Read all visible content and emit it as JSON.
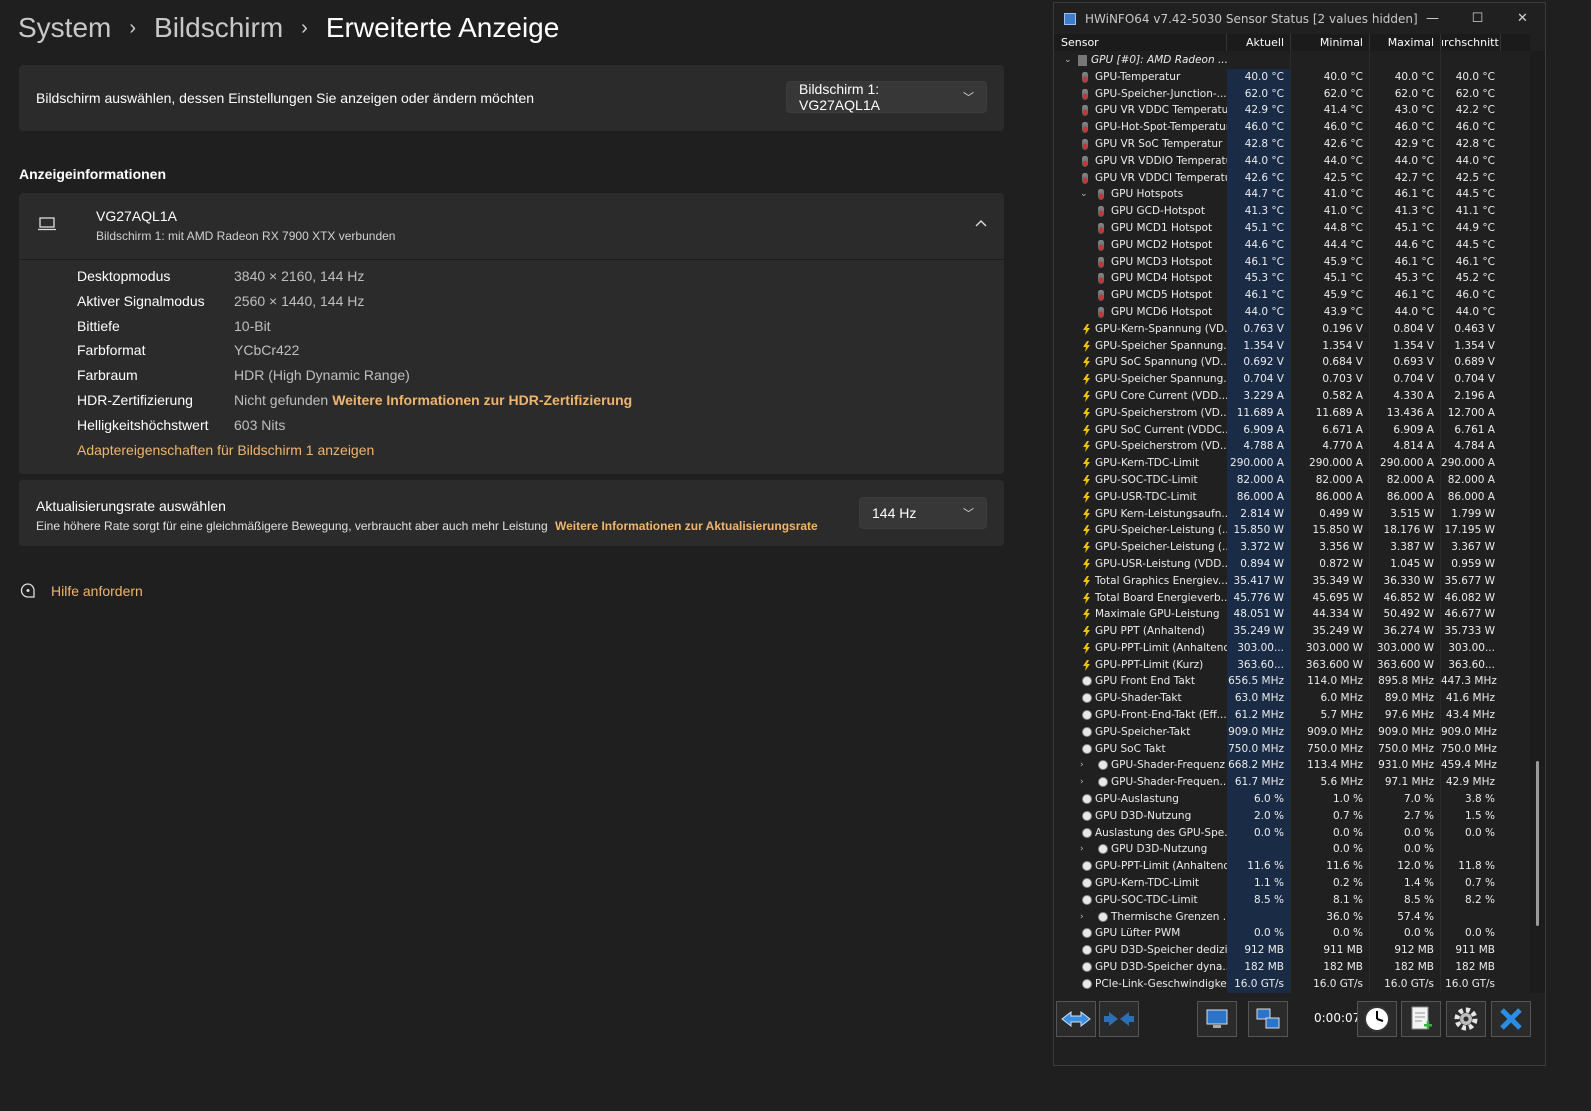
{
  "breadcrumb": {
    "system": "System",
    "bildschirm": "Bildschirm",
    "current": "Erweiterte Anzeige"
  },
  "monitor_select": {
    "label": "Bildschirm auswählen, dessen Einstellungen Sie anzeigen oder ändern möchten",
    "value": "Bildschirm 1: VG27AQL1A"
  },
  "section_title": "Anzeigeinformationen",
  "display": {
    "name": "VG27AQL1A",
    "subtitle": "Bildschirm 1: mit AMD Radeon RX 7900 XTX verbunden",
    "rows": [
      {
        "k": "Desktopmodus",
        "v": "3840 × 2160, 144 Hz"
      },
      {
        "k": "Aktiver Signalmodus",
        "v": "2560 × 1440, 144 Hz"
      },
      {
        "k": "Bittiefe",
        "v": "10-Bit"
      },
      {
        "k": "Farbformat",
        "v": "YCbCr422"
      },
      {
        "k": "Farbraum",
        "v": "HDR (High Dynamic Range)"
      },
      {
        "k": "HDR-Zertifizierung",
        "v": "Nicht gefunden",
        "link": "Weitere Informationen zur HDR-Zertifizierung"
      },
      {
        "k": "Helligkeitshöchstwert",
        "v": "603 Nits"
      }
    ],
    "adapter_link": "Adaptereigenschaften für Bildschirm 1 anzeigen"
  },
  "refresh": {
    "title": "Aktualisierungsrate auswählen",
    "subtitle": "Eine höhere Rate sorgt für eine gleichmäßigere Bewegung, verbraucht aber auch mehr Leistung",
    "link": "Weitere Informationen zur Aktualisierungsrate",
    "value": "144 Hz"
  },
  "help": "Hilfe anfordern",
  "hwinfo": {
    "title": "HWiNFO64 v7.42-5030 Sensor Status [2 values hidden]",
    "headers": [
      "Sensor",
      "Aktuell",
      "Minimal",
      "Maximal",
      "ırchschnitt"
    ],
    "timer": "0:00:07",
    "rows": [
      {
        "n": "GPU [#0]: AMD Radeon ...",
        "t": "group",
        "ind": 0,
        "exp": "v",
        "v": [
          "",
          "",
          "",
          ""
        ]
      },
      {
        "n": "GPU-Temperatur",
        "t": "temp",
        "ind": 1,
        "v": [
          "40.0 °C",
          "40.0 °C",
          "40.0 °C",
          "40.0 °C"
        ]
      },
      {
        "n": "GPU-Speicher-Junction-...",
        "t": "temp",
        "ind": 1,
        "v": [
          "62.0 °C",
          "62.0 °C",
          "62.0 °C",
          "62.0 °C"
        ]
      },
      {
        "n": "GPU VR VDDC Temperatur",
        "t": "temp",
        "ind": 1,
        "v": [
          "42.9 °C",
          "41.4 °C",
          "43.0 °C",
          "42.2 °C"
        ]
      },
      {
        "n": "GPU-Hot-Spot-Temperatur",
        "t": "temp",
        "ind": 1,
        "v": [
          "46.0 °C",
          "46.0 °C",
          "46.0 °C",
          "46.0 °C"
        ]
      },
      {
        "n": "GPU VR SoC Temperatur",
        "t": "temp",
        "ind": 1,
        "v": [
          "42.8 °C",
          "42.6 °C",
          "42.9 °C",
          "42.8 °C"
        ]
      },
      {
        "n": "GPU VR VDDIO Temperatur",
        "t": "temp",
        "ind": 1,
        "v": [
          "44.0 °C",
          "44.0 °C",
          "44.0 °C",
          "44.0 °C"
        ]
      },
      {
        "n": "GPU VR VDDCI Temperatur",
        "t": "temp",
        "ind": 1,
        "v": [
          "42.6 °C",
          "42.5 °C",
          "42.7 °C",
          "42.5 °C"
        ]
      },
      {
        "n": "GPU Hotspots",
        "t": "temp",
        "ind": 2,
        "exp": "v",
        "v": [
          "44.7 °C",
          "41.0 °C",
          "46.1 °C",
          "44.5 °C"
        ]
      },
      {
        "n": "GPU GCD-Hotspot",
        "t": "temp",
        "ind": 2,
        "v": [
          "41.3 °C",
          "41.0 °C",
          "41.3 °C",
          "41.1 °C"
        ]
      },
      {
        "n": "GPU MCD1 Hotspot",
        "t": "temp",
        "ind": 2,
        "v": [
          "45.1 °C",
          "44.8 °C",
          "45.1 °C",
          "44.9 °C"
        ]
      },
      {
        "n": "GPU MCD2 Hotspot",
        "t": "temp",
        "ind": 2,
        "v": [
          "44.6 °C",
          "44.4 °C",
          "44.6 °C",
          "44.5 °C"
        ]
      },
      {
        "n": "GPU MCD3 Hotspot",
        "t": "temp",
        "ind": 2,
        "v": [
          "46.1 °C",
          "45.9 °C",
          "46.1 °C",
          "46.1 °C"
        ]
      },
      {
        "n": "GPU MCD4 Hotspot",
        "t": "temp",
        "ind": 2,
        "v": [
          "45.3 °C",
          "45.1 °C",
          "45.3 °C",
          "45.2 °C"
        ]
      },
      {
        "n": "GPU MCD5 Hotspot",
        "t": "temp",
        "ind": 2,
        "v": [
          "46.1 °C",
          "45.9 °C",
          "46.1 °C",
          "46.0 °C"
        ]
      },
      {
        "n": "GPU MCD6 Hotspot",
        "t": "temp",
        "ind": 2,
        "v": [
          "44.0 °C",
          "43.9 °C",
          "44.0 °C",
          "44.0 °C"
        ]
      },
      {
        "n": "GPU-Kern-Spannung (VD...",
        "t": "volt",
        "ind": 1,
        "v": [
          "0.763 V",
          "0.196 V",
          "0.804 V",
          "0.463 V"
        ]
      },
      {
        "n": "GPU-Speicher Spannung...",
        "t": "volt",
        "ind": 1,
        "v": [
          "1.354 V",
          "1.354 V",
          "1.354 V",
          "1.354 V"
        ]
      },
      {
        "n": "GPU SoC Spannung (VD...",
        "t": "volt",
        "ind": 1,
        "v": [
          "0.692 V",
          "0.684 V",
          "0.693 V",
          "0.689 V"
        ]
      },
      {
        "n": "GPU-Speicher Spannung...",
        "t": "volt",
        "ind": 1,
        "v": [
          "0.704 V",
          "0.703 V",
          "0.704 V",
          "0.704 V"
        ]
      },
      {
        "n": "GPU Core Current (VDD...",
        "t": "volt",
        "ind": 1,
        "v": [
          "3.229 A",
          "0.582 A",
          "4.330 A",
          "2.196 A"
        ]
      },
      {
        "n": "GPU-Speicherstrom (VD...",
        "t": "volt",
        "ind": 1,
        "v": [
          "11.689 A",
          "11.689 A",
          "13.436 A",
          "12.700 A"
        ]
      },
      {
        "n": "GPU SoC Current (VDDC...",
        "t": "volt",
        "ind": 1,
        "v": [
          "6.909 A",
          "6.671 A",
          "6.909 A",
          "6.761 A"
        ]
      },
      {
        "n": "GPU-Speicherstrom (VD...",
        "t": "volt",
        "ind": 1,
        "v": [
          "4.788 A",
          "4.770 A",
          "4.814 A",
          "4.784 A"
        ]
      },
      {
        "n": "GPU-Kern-TDC-Limit",
        "t": "volt",
        "ind": 1,
        "v": [
          "290.000 A",
          "290.000 A",
          "290.000 A",
          "290.000 A"
        ]
      },
      {
        "n": "GPU-SOC-TDC-Limit",
        "t": "volt",
        "ind": 1,
        "v": [
          "82.000 A",
          "82.000 A",
          "82.000 A",
          "82.000 A"
        ]
      },
      {
        "n": "GPU-USR-TDC-Limit",
        "t": "volt",
        "ind": 1,
        "v": [
          "86.000 A",
          "86.000 A",
          "86.000 A",
          "86.000 A"
        ]
      },
      {
        "n": "GPU Kern-Leistungsaufn...",
        "t": "volt",
        "ind": 1,
        "v": [
          "2.814 W",
          "0.499 W",
          "3.515 W",
          "1.799 W"
        ]
      },
      {
        "n": "GPU-Speicher-Leistung (...",
        "t": "volt",
        "ind": 1,
        "v": [
          "15.850 W",
          "15.850 W",
          "18.176 W",
          "17.195 W"
        ]
      },
      {
        "n": "GPU-Speicher-Leistung (...",
        "t": "volt",
        "ind": 1,
        "v": [
          "3.372 W",
          "3.356 W",
          "3.387 W",
          "3.367 W"
        ]
      },
      {
        "n": "GPU-USR-Leistung (VDD...",
        "t": "volt",
        "ind": 1,
        "v": [
          "0.894 W",
          "0.872 W",
          "1.045 W",
          "0.959 W"
        ]
      },
      {
        "n": "Total Graphics Energiev...",
        "t": "volt",
        "ind": 1,
        "v": [
          "35.417 W",
          "35.349 W",
          "36.330 W",
          "35.677 W"
        ]
      },
      {
        "n": "Total Board Energieverb...",
        "t": "volt",
        "ind": 1,
        "v": [
          "45.776 W",
          "45.695 W",
          "46.852 W",
          "46.082 W"
        ]
      },
      {
        "n": "Maximale GPU-Leistung",
        "t": "volt",
        "ind": 1,
        "v": [
          "48.051 W",
          "44.334 W",
          "50.492 W",
          "46.677 W"
        ]
      },
      {
        "n": "GPU PPT (Anhaltend)",
        "t": "volt",
        "ind": 1,
        "v": [
          "35.249 W",
          "35.249 W",
          "36.274 W",
          "35.733 W"
        ]
      },
      {
        "n": "GPU-PPT-Limit (Anhaltend)",
        "t": "volt",
        "ind": 1,
        "v": [
          "303.00...",
          "303.000 W",
          "303.000 W",
          "303.00..."
        ]
      },
      {
        "n": "GPU-PPT-Limit (Kurz)",
        "t": "volt",
        "ind": 1,
        "v": [
          "363.60...",
          "363.600 W",
          "363.600 W",
          "363.60..."
        ]
      },
      {
        "n": "GPU Front End Takt",
        "t": "clock",
        "ind": 1,
        "v": [
          "656.5 MHz",
          "114.0 MHz",
          "895.8 MHz",
          "447.3 MHz"
        ]
      },
      {
        "n": "GPU-Shader-Takt",
        "t": "clock",
        "ind": 1,
        "v": [
          "63.0 MHz",
          "6.0 MHz",
          "89.0 MHz",
          "41.6 MHz"
        ]
      },
      {
        "n": "GPU-Front-End-Takt (Eff...",
        "t": "clock",
        "ind": 1,
        "v": [
          "61.2 MHz",
          "5.7 MHz",
          "97.6 MHz",
          "43.4 MHz"
        ]
      },
      {
        "n": "GPU-Speicher-Takt",
        "t": "clock",
        "ind": 1,
        "v": [
          "909.0 MHz",
          "909.0 MHz",
          "909.0 MHz",
          "909.0 MHz"
        ]
      },
      {
        "n": "GPU SoC Takt",
        "t": "clock",
        "ind": 1,
        "v": [
          "750.0 MHz",
          "750.0 MHz",
          "750.0 MHz",
          "750.0 MHz"
        ]
      },
      {
        "n": "GPU-Shader-Frequenz",
        "t": "clock",
        "ind": 2,
        "exp": ">",
        "v": [
          "668.2 MHz",
          "113.4 MHz",
          "931.0 MHz",
          "459.4 MHz"
        ]
      },
      {
        "n": "GPU-Shader-Frequen...",
        "t": "clock",
        "ind": 2,
        "exp": ">",
        "v": [
          "61.7 MHz",
          "5.6 MHz",
          "97.1 MHz",
          "42.9 MHz"
        ]
      },
      {
        "n": "GPU-Auslastung",
        "t": "clock",
        "ind": 1,
        "v": [
          "6.0 %",
          "1.0 %",
          "7.0 %",
          "3.8 %"
        ]
      },
      {
        "n": "GPU D3D-Nutzung",
        "t": "clock",
        "ind": 1,
        "v": [
          "2.0 %",
          "0.7 %",
          "2.7 %",
          "1.5 %"
        ]
      },
      {
        "n": "Auslastung des GPU-Spe...",
        "t": "clock",
        "ind": 1,
        "v": [
          "0.0 %",
          "0.0 %",
          "0.0 %",
          "0.0 %"
        ]
      },
      {
        "n": "GPU D3D-Nutzung",
        "t": "clock",
        "ind": 2,
        "exp": ">",
        "v": [
          "",
          "0.0 %",
          "0.0 %",
          ""
        ]
      },
      {
        "n": "GPU-PPT-Limit (Anhaltend)",
        "t": "clock",
        "ind": 1,
        "v": [
          "11.6 %",
          "11.6 %",
          "12.0 %",
          "11.8 %"
        ]
      },
      {
        "n": "GPU-Kern-TDC-Limit",
        "t": "clock",
        "ind": 1,
        "v": [
          "1.1 %",
          "0.2 %",
          "1.4 %",
          "0.7 %"
        ]
      },
      {
        "n": "GPU-SOC-TDC-Limit",
        "t": "clock",
        "ind": 1,
        "v": [
          "8.5 %",
          "8.1 %",
          "8.5 %",
          "8.2 %"
        ]
      },
      {
        "n": "Thermische Grenzen ...",
        "t": "clock",
        "ind": 2,
        "exp": ">",
        "v": [
          "",
          "36.0 %",
          "57.4 %",
          ""
        ]
      },
      {
        "n": "GPU Lüfter PWM",
        "t": "clock",
        "ind": 1,
        "v": [
          "0.0 %",
          "0.0 %",
          "0.0 %",
          "0.0 %"
        ]
      },
      {
        "n": "GPU D3D-Speicher dedizi...",
        "t": "clock",
        "ind": 1,
        "v": [
          "912 MB",
          "911 MB",
          "912 MB",
          "911 MB"
        ]
      },
      {
        "n": "GPU D3D-Speicher dyna...",
        "t": "clock",
        "ind": 1,
        "v": [
          "182 MB",
          "182 MB",
          "182 MB",
          "182 MB"
        ]
      },
      {
        "n": "PCIe-Link-Geschwindigkeit",
        "t": "clock",
        "ind": 1,
        "v": [
          "16.0 GT/s",
          "16.0 GT/s",
          "16.0 GT/s",
          "16.0 GT/s"
        ]
      }
    ]
  }
}
